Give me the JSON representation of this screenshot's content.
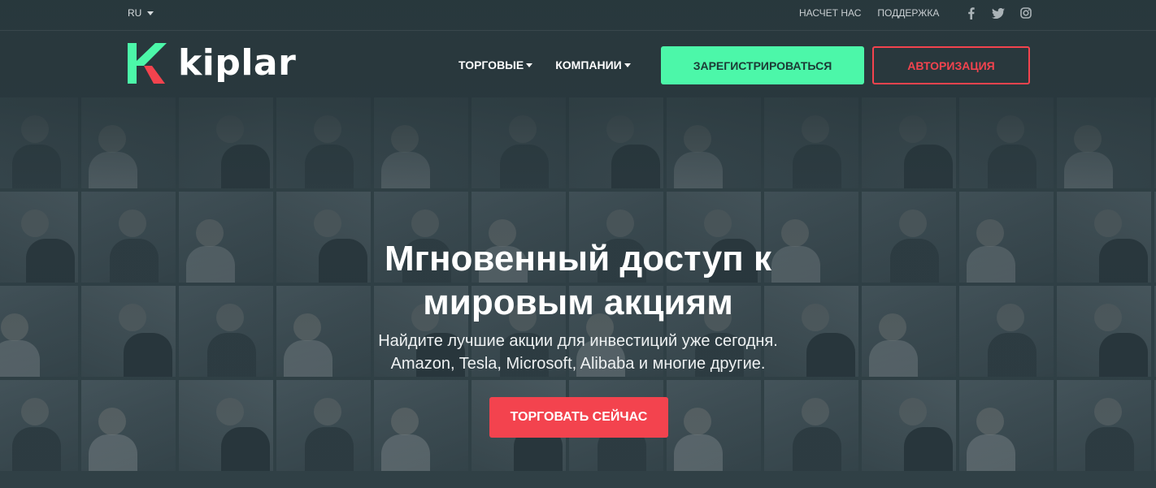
{
  "topbar": {
    "language": "RU",
    "links": [
      "НАСЧЕТ НАС",
      "ПОДДЕРЖКА"
    ],
    "socials": [
      "facebook-icon",
      "twitter-icon",
      "instagram-icon"
    ]
  },
  "header": {
    "logo_text": "kiplar",
    "nav": [
      "ТОРГОВЫЕ",
      "КОМПАНИИ"
    ],
    "register_label": "ЗАРЕГИСТРИРОВАТЬСЯ",
    "login_label": "АВТОРИЗАЦИЯ"
  },
  "hero": {
    "title_line1": "Мгновенный доступ к",
    "title_line2": "мировым акциям",
    "subtitle_line1": "Найдите лучшие акции для инвестиций уже сегодня.",
    "subtitle_line2": "Amazon, Tesla, Microsoft, Alibaba и многие другие.",
    "cta_label": "ТОРГОВАТЬ СЕЙЧАС"
  },
  "colors": {
    "accent_green": "#4cf7a9",
    "accent_red": "#f3434e",
    "background": "#2f3f44"
  }
}
